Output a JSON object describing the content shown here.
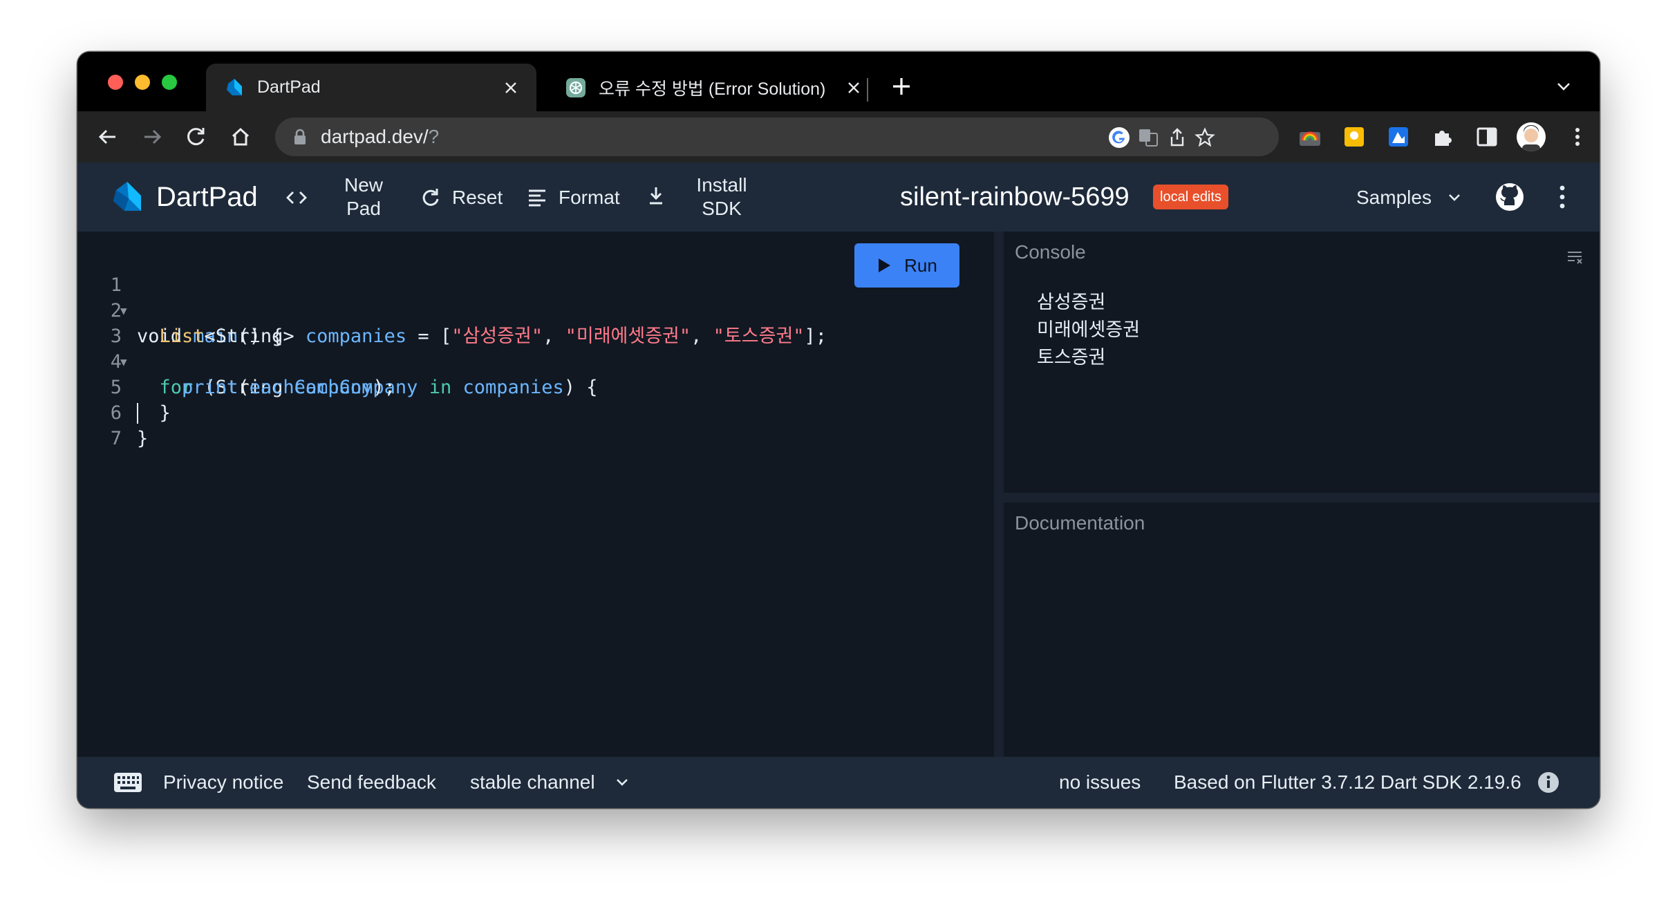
{
  "browser": {
    "tabs": [
      {
        "title": "DartPad",
        "active": true
      },
      {
        "title": "오류 수정 방법 (Error Solution)",
        "active": false
      }
    ],
    "url_host": "dartpad.dev/",
    "url_rest": "?"
  },
  "dartpad": {
    "app_title": "DartPad",
    "new_pad_line1": "New",
    "new_pad_line2": "Pad",
    "reset_label": "Reset",
    "format_label": "Format",
    "install_line1": "Install",
    "install_line2": "SDK",
    "pad_name": "silent-rainbow-5699",
    "badge": "local edits",
    "samples_label": "Samples",
    "run_label": "Run"
  },
  "editor": {
    "line_numbers": [
      "1",
      "2",
      "3",
      "4",
      "5",
      "6",
      "7"
    ],
    "line1": {
      "kw": "void",
      "fn": "main",
      "rest": "() {"
    },
    "line2": {
      "type": "List",
      "generic": "<String>",
      "name": "companies",
      "eq": " = [",
      "s1": "\"삼성증권\"",
      "s2": "\"미래에셋증권\"",
      "s3": "\"토스증권\"",
      "sep": ", ",
      "end": "];"
    },
    "line3": {
      "kw": "for",
      "open": " (String ",
      "var": "eachCompany",
      "in": "in",
      "list": "companies",
      "close": ") {"
    },
    "line4": {
      "fn": "print",
      "open": "(",
      "arg": "eachCompany",
      "close": ");"
    },
    "line5": "}",
    "line6": "}"
  },
  "console": {
    "title": "Console",
    "output": [
      "삼성증권",
      "미래에셋증권",
      "토스증권"
    ]
  },
  "documentation": {
    "title": "Documentation"
  },
  "footer": {
    "privacy": "Privacy notice",
    "feedback": "Send feedback",
    "channel": "stable channel",
    "issues": "no issues",
    "version": "Based on Flutter 3.7.12 Dart SDK 2.19.6"
  },
  "colors": {
    "run_button": "#3b82f6",
    "badge": "#e8502b",
    "header_bg": "#1e2a3a",
    "editor_bg": "#111822"
  }
}
